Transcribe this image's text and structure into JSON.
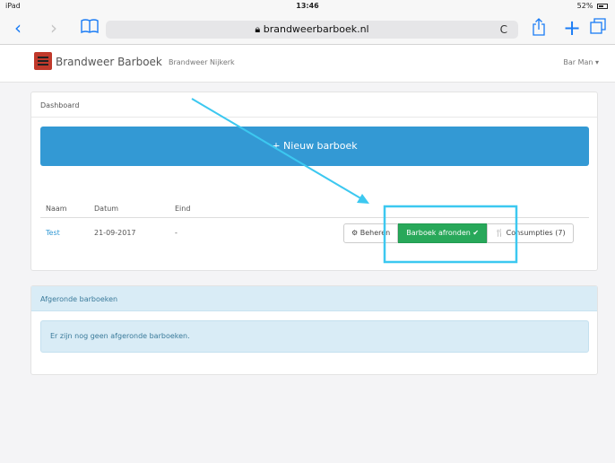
{
  "status": {
    "device": "iPad",
    "time": "13:46",
    "battery": "52%"
  },
  "browser": {
    "url": "brandweerbarboek.nl",
    "reload": "C"
  },
  "nav": {
    "brand": "Brandweer Barboek",
    "org": "Brandweer Nijkerk",
    "user": "Bar Man ▾"
  },
  "dashboard": {
    "heading": "Dashboard",
    "new_button": "+ Nieuw barboek",
    "columns": {
      "naam": "Naam",
      "datum": "Datum",
      "eind": "Eind"
    },
    "rows": [
      {
        "naam": "Test",
        "datum": "21-09-2017",
        "eind": "-",
        "actions": {
          "beheren": "⚙ Beheren",
          "afronden": "Barboek afronden ✔",
          "consumpties": "🍴 Consumpties (7)"
        }
      }
    ]
  },
  "finished": {
    "heading": "Afgeronde barboeken",
    "empty": "Er zijn nog geen afgeronde barboeken."
  },
  "colors": {
    "primary": "#3399d4",
    "success": "#28a85a",
    "annotation": "#3cc8f0"
  }
}
